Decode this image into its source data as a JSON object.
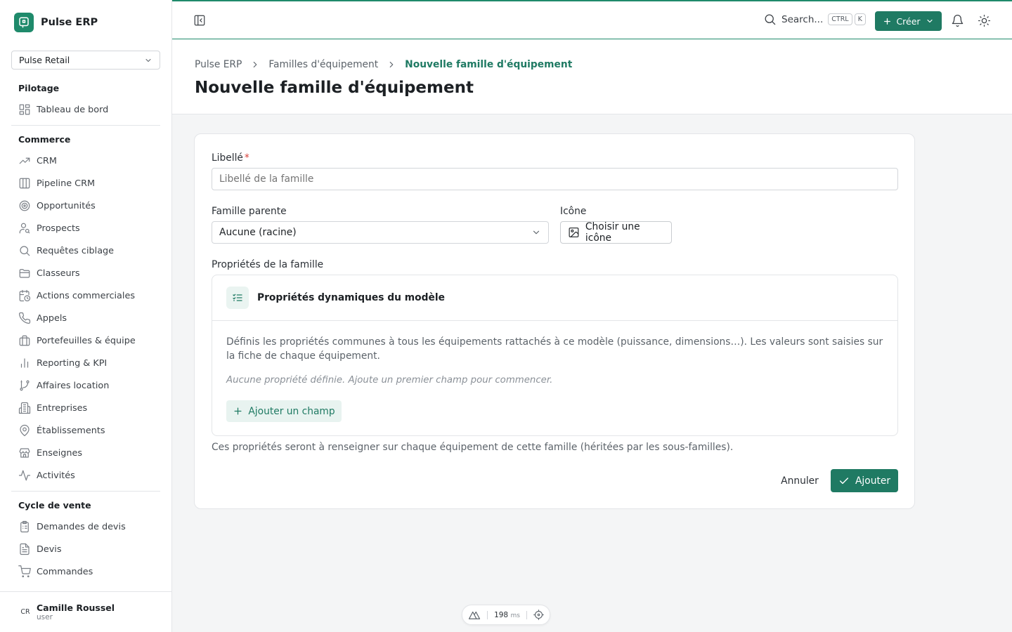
{
  "brand": {
    "name": "Pulse ERP"
  },
  "org_select": {
    "value": "Pulse Retail"
  },
  "sidebar": {
    "sections": [
      {
        "title": "Pilotage",
        "items": [
          {
            "label": "Tableau de bord",
            "icon": "dashboard-icon"
          }
        ]
      },
      {
        "title": "Commerce",
        "items": [
          {
            "label": "CRM",
            "icon": "trend-icon"
          },
          {
            "label": "Pipeline CRM",
            "icon": "columns-icon"
          },
          {
            "label": "Opportunités",
            "icon": "target-icon"
          },
          {
            "label": "Prospects",
            "icon": "user-search-icon"
          },
          {
            "label": "Requêtes ciblage",
            "icon": "search-icon"
          },
          {
            "label": "Classeurs",
            "icon": "folder-icon"
          },
          {
            "label": "Actions commerciales",
            "icon": "calendar-clock-icon"
          },
          {
            "label": "Appels",
            "icon": "phone-icon"
          },
          {
            "label": "Portefeuilles & équipe",
            "icon": "briefcase-icon"
          },
          {
            "label": "Reporting & KPI",
            "icon": "bar-chart-icon"
          },
          {
            "label": "Affaires location",
            "icon": "git-branch-icon"
          },
          {
            "label": "Entreprises",
            "icon": "building-icon"
          },
          {
            "label": "Établissements",
            "icon": "map-pin-icon"
          },
          {
            "label": "Enseignes",
            "icon": "store-icon"
          },
          {
            "label": "Activités",
            "icon": "activity-icon"
          }
        ]
      },
      {
        "title": "Cycle de vente",
        "items": [
          {
            "label": "Demandes de devis",
            "icon": "clipboard-list-icon"
          },
          {
            "label": "Devis",
            "icon": "file-text-icon"
          },
          {
            "label": "Commandes",
            "icon": "cart-icon"
          }
        ]
      }
    ]
  },
  "user": {
    "initials": "CR",
    "name": "Camille Roussel",
    "role": "user"
  },
  "topbar": {
    "search_label": "Search...",
    "shortcut_keys": [
      "CTRL",
      "K"
    ],
    "create_label": "Créer"
  },
  "breadcrumb": [
    "Pulse ERP",
    "Familles d'équipement",
    "Nouvelle famille d'équipement"
  ],
  "page_title": "Nouvelle famille d'équipement",
  "form": {
    "label_field": {
      "label": "Libellé",
      "required_mark": "*",
      "placeholder": "Libellé de la famille"
    },
    "parent_field": {
      "label": "Famille parente",
      "value": "Aucune (racine)"
    },
    "icon_field": {
      "label": "Icône",
      "button_label": "Choisir une icône"
    },
    "properties": {
      "section_label": "Propriétés de la famille",
      "title": "Propriétés dynamiques du modèle",
      "description": "Définis les propriétés communes à tous les équipements rattachés à ce modèle (puissance, dimensions…). Les valeurs sont saisies sur la fiche de chaque équipement.",
      "empty_state": "Aucune propriété définie. Ajoute un premier champ pour commencer.",
      "add_button": "Ajouter un champ"
    },
    "hint": "Ces propriétés seront à renseigner sur chaque équipement de cette famille (héritées par les sous-familles).",
    "cancel_label": "Annuler",
    "submit_label": "Ajouter"
  },
  "devtools": {
    "value": "198",
    "unit": "ms"
  },
  "colors": {
    "accent": "#1f7a63",
    "required": "#d8413a"
  }
}
